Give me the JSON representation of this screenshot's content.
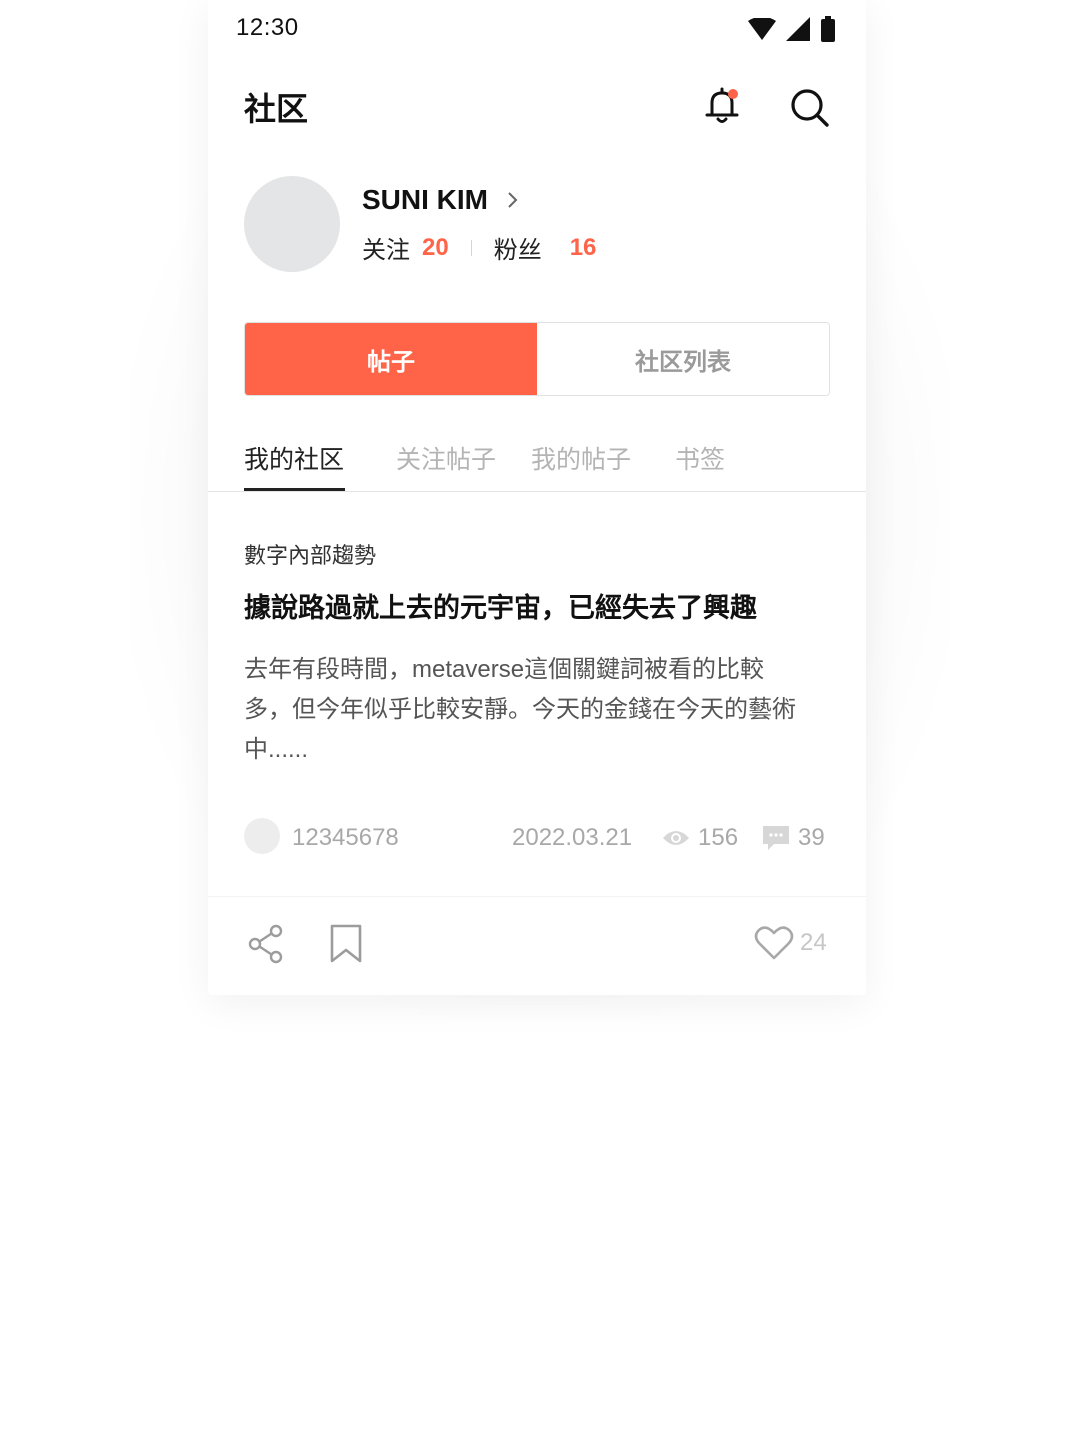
{
  "status_bar": {
    "time": "12:30",
    "icons": [
      "wifi-icon",
      "signal-icon",
      "battery-icon"
    ]
  },
  "header": {
    "title": "社区",
    "icons": [
      "bell-icon",
      "search-icon"
    ],
    "notification_dot_color": "#ff6449"
  },
  "profile": {
    "name": "SUNI KIM",
    "following_label": "关注",
    "following_count": "20",
    "followers_label": "粉丝",
    "followers_count": "16"
  },
  "segment": {
    "active_label": "帖子",
    "inactive_label": "社区列表"
  },
  "subtabs": [
    {
      "label": "我的社区",
      "active": true
    },
    {
      "label": "关注帖子",
      "active": false
    },
    {
      "label": "我的帖子",
      "active": false
    },
    {
      "label": "书签",
      "active": false
    }
  ],
  "post": {
    "category": "數字內部趨勢",
    "title": "據說路過就上去的元宇宙，已經失去了興趣",
    "body_lines": [
      "去年有段時間，metaverse這個關鍵詞被看的比較",
      "多，但今年似乎比較安靜。今天的金錢在今天的藝術",
      "中......"
    ],
    "user_id": "12345678",
    "date": "2022.03.21",
    "views": "156",
    "comments": "39"
  },
  "actions": {
    "likes": "24"
  },
  "colors": {
    "accent": "#ff6449",
    "text_primary": "#111111",
    "text_muted": "#a8a8a8"
  }
}
